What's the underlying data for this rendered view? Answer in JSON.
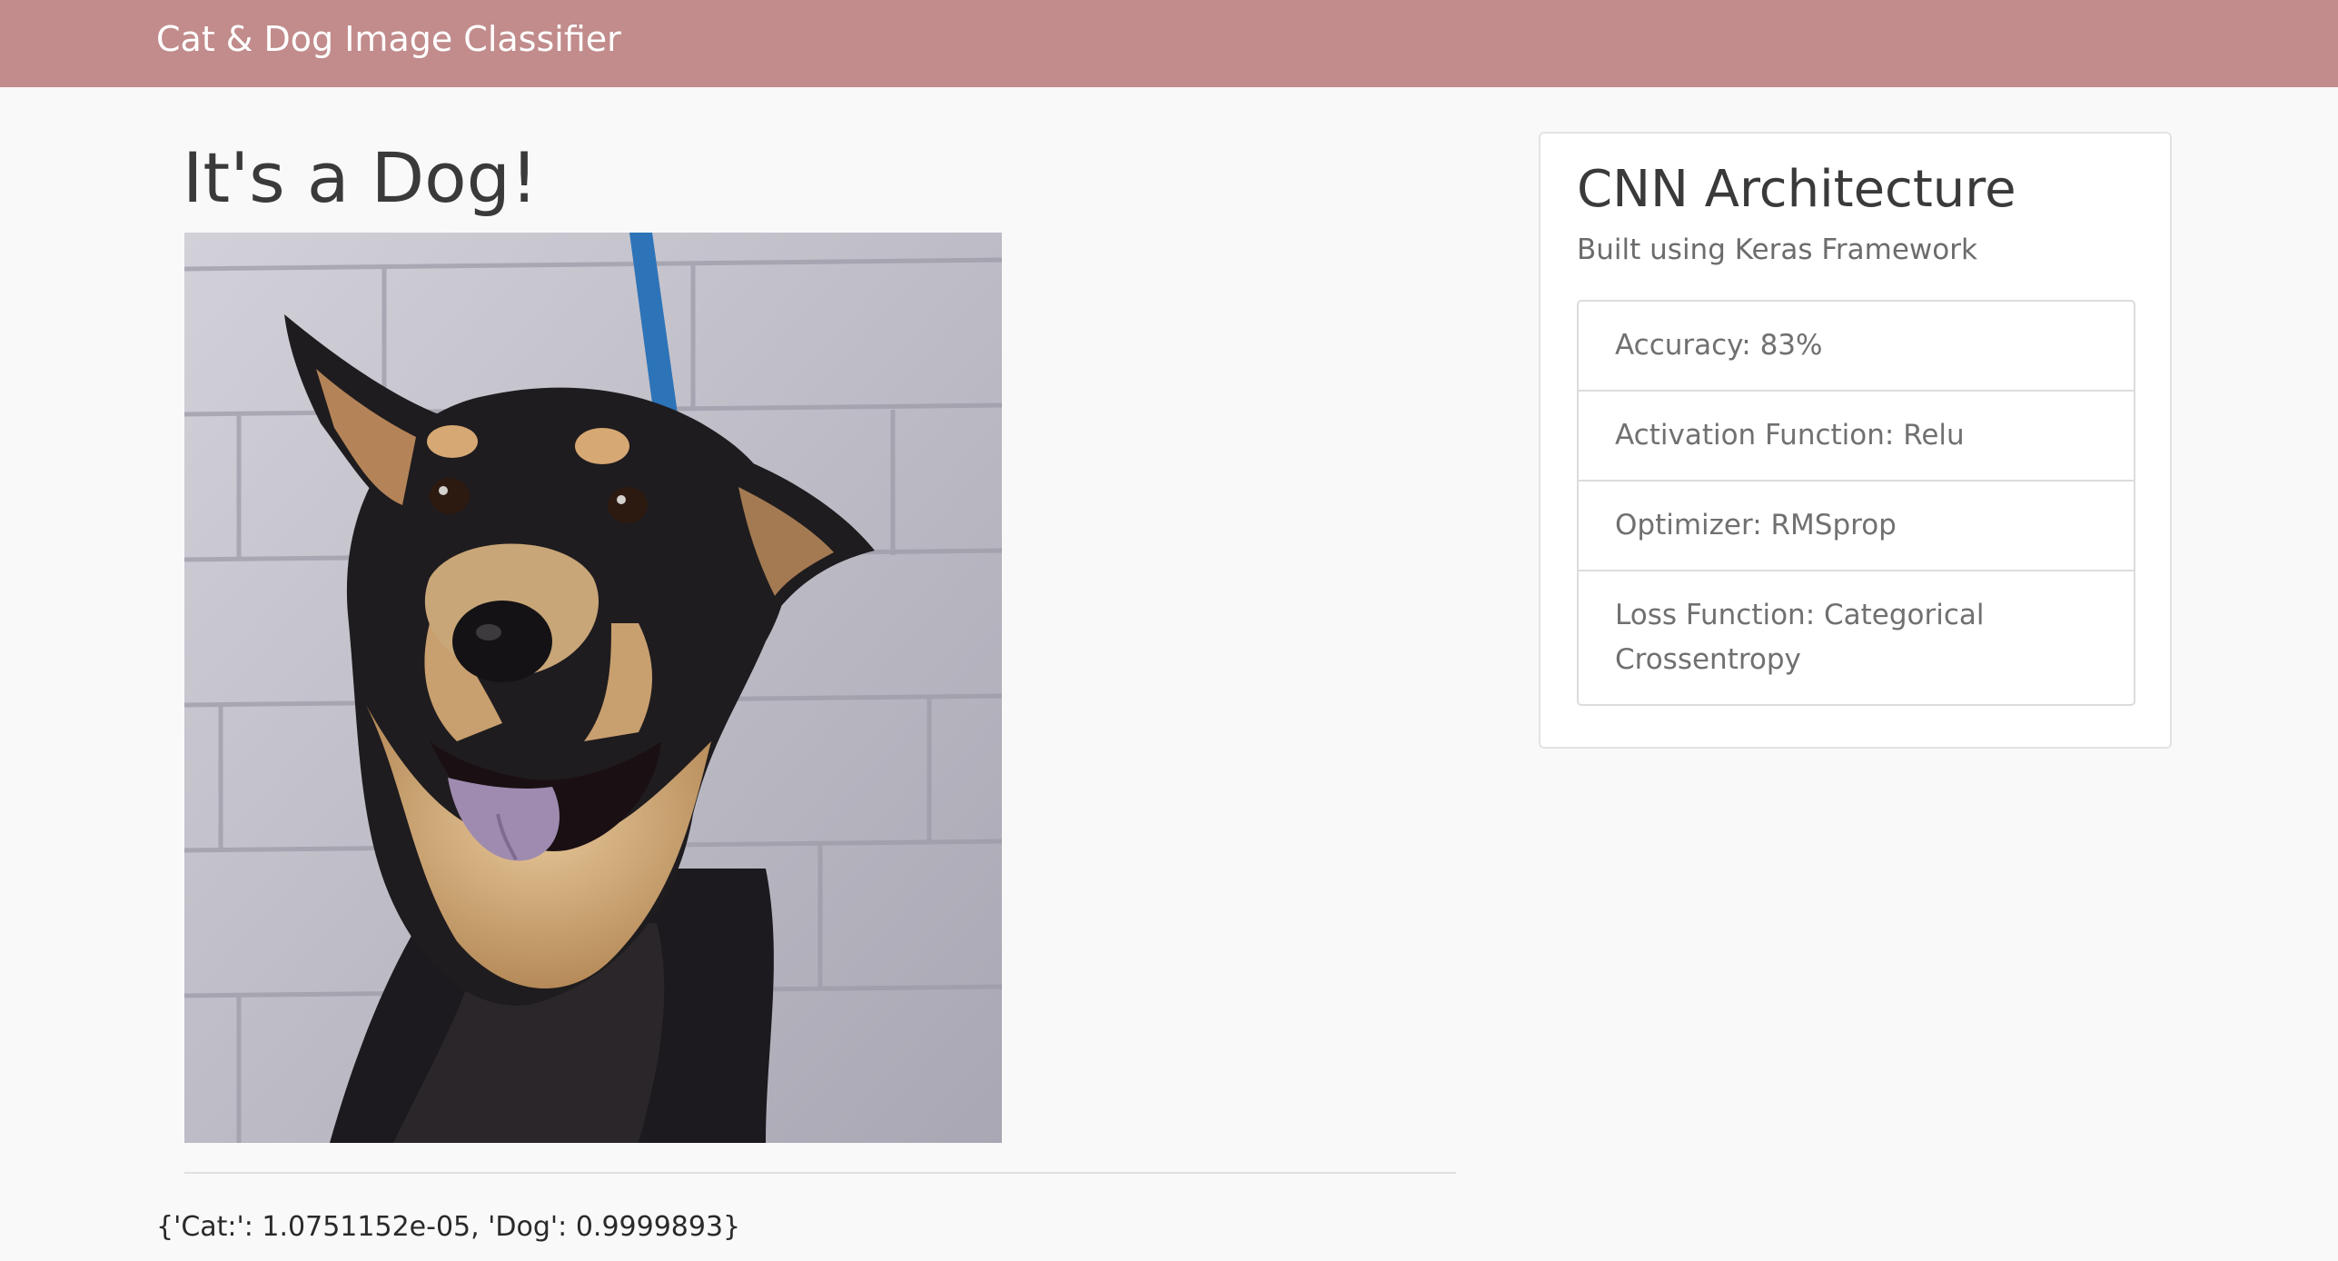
{
  "navbar": {
    "brand": "Cat & Dog Image Classifier",
    "background_color": "#c28c8c"
  },
  "result": {
    "heading": "It's a Dog!",
    "image_subject": "dog-photo",
    "probabilities_text": "{'Cat:': 1.0751152e-05, 'Dog': 0.9999893}"
  },
  "architecture": {
    "title": "CNN Architecture",
    "subtitle": "Built using Keras Framework",
    "items": [
      {
        "label": "Accuracy: 83%"
      },
      {
        "label": "Activation Function: Relu"
      },
      {
        "label": "Optimizer: RMSprop"
      },
      {
        "label": "Loss Function: Categorical Crossentropy"
      }
    ]
  }
}
